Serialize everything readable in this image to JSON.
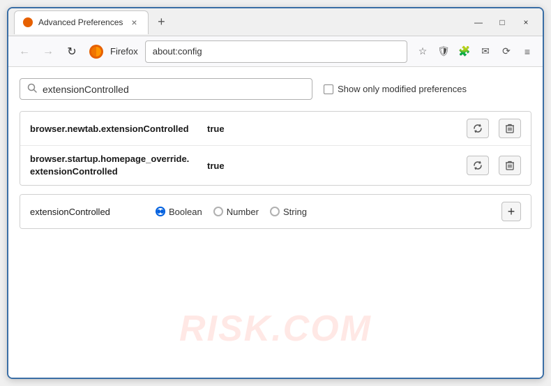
{
  "browser": {
    "tab_title": "Advanced Preferences",
    "tab_close": "×",
    "new_tab_icon": "+",
    "win_minimize": "—",
    "win_maximize": "□",
    "win_close": "×"
  },
  "navbar": {
    "back_icon": "←",
    "forward_icon": "→",
    "reload_icon": "↻",
    "firefox_label": "Firefox",
    "address": "about:config",
    "bookmark_icon": "☆",
    "shield_icon": "🛡",
    "ext_icon": "🧩",
    "email_icon": "✉",
    "sync_icon": "⟳",
    "menu_icon": "≡"
  },
  "search": {
    "placeholder": "extensionControlled",
    "value": "extensionControlled",
    "modified_label": "Show only modified preferences"
  },
  "preferences": {
    "rows": [
      {
        "name": "browser.newtab.extensionControlled",
        "value": "true"
      },
      {
        "name_line1": "browser.startup.homepage_override.",
        "name_line2": "extensionControlled",
        "value": "true"
      }
    ]
  },
  "new_pref": {
    "name": "extensionControlled",
    "types": [
      {
        "label": "Boolean",
        "checked": true
      },
      {
        "label": "Number",
        "checked": false
      },
      {
        "label": "String",
        "checked": false
      }
    ],
    "add_icon": "+"
  },
  "watermark": "RISK.COM"
}
